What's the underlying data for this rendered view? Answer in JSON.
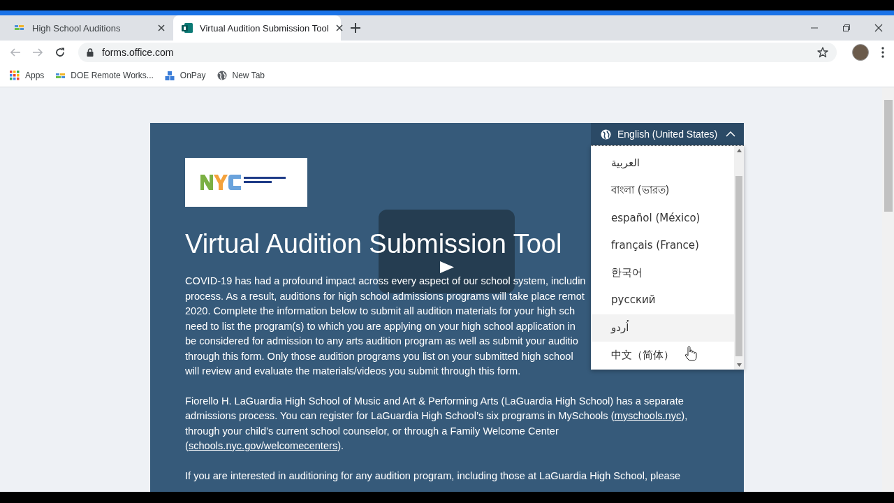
{
  "browser": {
    "tabs": [
      {
        "title": "High School Auditions",
        "selected": false
      },
      {
        "title": "Virtual Audition Submission Tool",
        "selected": true
      }
    ],
    "url": "forms.office.com",
    "bookmarks": [
      {
        "label": "Apps",
        "kind": "apps"
      },
      {
        "label": "DOE Remote Works...",
        "kind": "doe"
      },
      {
        "label": "OnPay",
        "kind": "onpay"
      },
      {
        "label": "New Tab",
        "kind": "globe"
      }
    ]
  },
  "form": {
    "title": "Virtual Audition Submission Tool",
    "paragraphs": [
      {
        "lines": [
          [
            {
              "text": "COVID-19 has had a profound impact across every aspect of our school system, includin"
            }
          ],
          [
            {
              "text": "process. As a result, auditions for high school admissions programs will take place remot"
            }
          ],
          [
            {
              "text": "2020. Complete the information below to submit all audition materials for your high sch"
            }
          ],
          [
            {
              "text": "need to list the program(s) to which you are applying on your high school application in"
            }
          ],
          [
            {
              "text": "be considered for admission to any arts audition program as well as submit your auditio"
            }
          ],
          [
            {
              "text": "through this form. Only those audition programs you list on your submitted high school"
            }
          ],
          [
            {
              "text": "will review and evaluate the materials/videos you submit through this form."
            }
          ]
        ]
      },
      {
        "lines": [
          [
            {
              "text": "Fiorello H. LaGuardia High School of Music and Art & Performing Arts (LaGuardia High School) has a separate"
            }
          ],
          [
            {
              "text": "admissions process. You can register for LaGuardia High School’s six programs in MySchools ("
            },
            {
              "text": "myschools.nyc",
              "link": true
            },
            {
              "text": "),"
            }
          ],
          [
            {
              "text": "through your child’s current school counselor, or through a Family Welcome Center"
            }
          ],
          [
            {
              "text": "("
            },
            {
              "text": "schools.nyc.gov/welcomecenters",
              "link": true
            },
            {
              "text": ")."
            }
          ]
        ]
      },
      {
        "lines": [
          [
            {
              "text": "If you are interested in auditioning for any audition program, including those at LaGuardia High School, please"
            }
          ]
        ]
      }
    ]
  },
  "language_menu": {
    "current": "English (United States)",
    "expanded": true,
    "options": [
      {
        "label": "العربية",
        "highlighted": false
      },
      {
        "label": "বাংলা (ভারত)",
        "highlighted": false
      },
      {
        "label": "español (México)",
        "highlighted": false
      },
      {
        "label": "français (France)",
        "highlighted": false
      },
      {
        "label": "한국어",
        "highlighted": false
      },
      {
        "label": "русский",
        "highlighted": false
      },
      {
        "label": "اُردو",
        "highlighted": true
      },
      {
        "label": "中文（简体）",
        "highlighted": false
      }
    ]
  },
  "video_overlay": {
    "kind": "play"
  }
}
